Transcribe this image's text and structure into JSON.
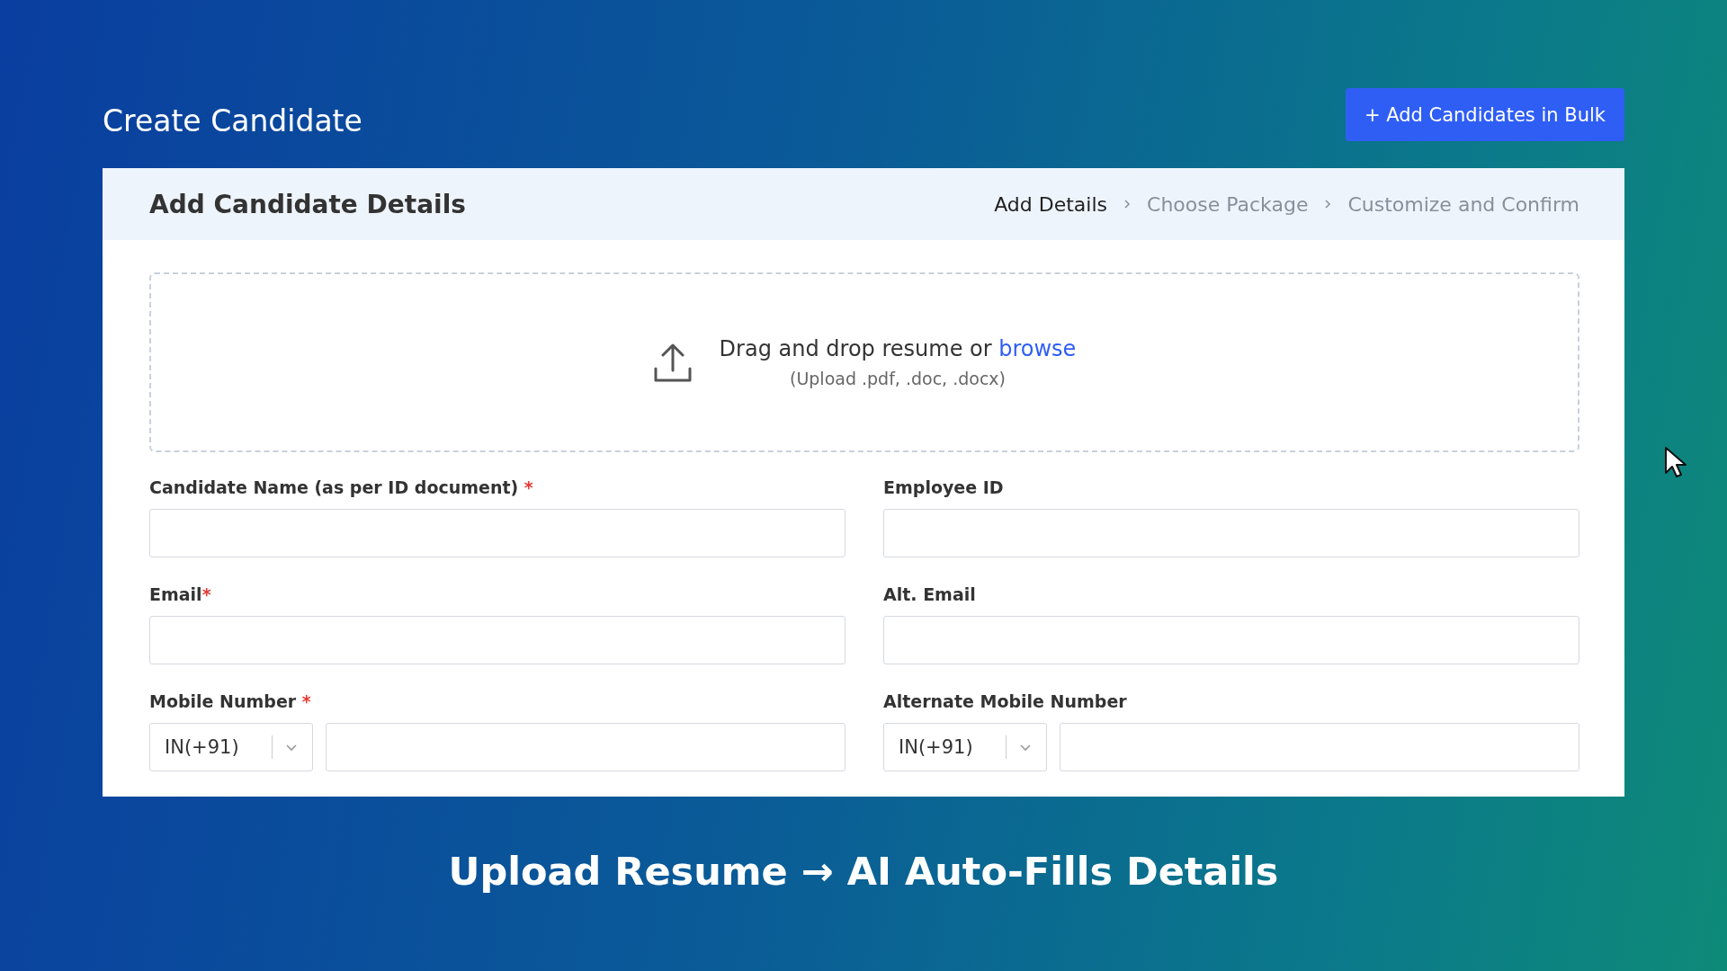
{
  "page_title": "Create Candidate",
  "bulk_button": "+ Add Candidates in Bulk",
  "card": {
    "title": "Add Candidate Details",
    "steps": [
      {
        "label": "Add Details",
        "selected": true
      },
      {
        "label": "Choose Package",
        "selected": false
      },
      {
        "label": "Customize and Confirm",
        "selected": false
      }
    ],
    "upload": {
      "text": "Drag and drop resume or",
      "link": "browse",
      "hint": "(Upload .pdf, .doc, .docx)"
    },
    "fields": [
      {
        "kind": "text",
        "label": "Candidate Name (as per ID document)",
        "required_mark": " *"
      },
      {
        "kind": "text",
        "label": "Employee ID"
      },
      {
        "kind": "text",
        "label": "Email",
        "required_mark": "*"
      },
      {
        "kind": "text",
        "label": "Alt. Email"
      },
      {
        "kind": "phone",
        "label": "Mobile Number",
        "required_mark": " *",
        "country_code": "IN(+91)"
      },
      {
        "kind": "phone",
        "label": "Alternate Mobile Number",
        "country_code": "IN(+91)"
      }
    ]
  },
  "caption": "Upload Resume → AI Auto-Fills Details"
}
